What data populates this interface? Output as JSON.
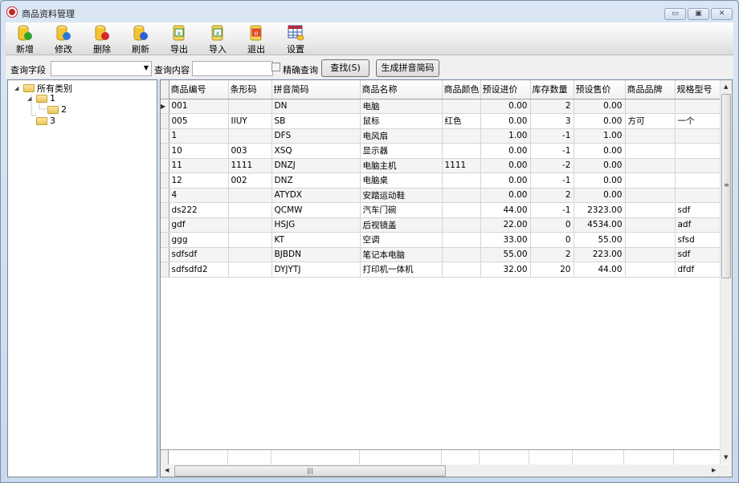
{
  "window": {
    "title": "商品资料管理",
    "controls": {
      "minimize": "▭",
      "maximize": "▣",
      "close": "✕"
    }
  },
  "toolbar": [
    {
      "label": "新增",
      "icon": "db-add-icon",
      "accent": "#2fa52f"
    },
    {
      "label": "修改",
      "icon": "db-edit-icon",
      "accent": "#2a7ad6"
    },
    {
      "label": "删除",
      "icon": "db-delete-icon",
      "accent": "#d8262a"
    },
    {
      "label": "刷新",
      "icon": "db-refresh-icon",
      "accent": "#2e5fd8"
    },
    {
      "label": "导出",
      "icon": "excel-export-icon",
      "accent": "#1f8a3c"
    },
    {
      "label": "导入",
      "icon": "excel-import-icon",
      "accent": "#1f8a3c"
    },
    {
      "label": "退出",
      "icon": "exit-icon",
      "accent": "#d8402a"
    },
    {
      "label": "设置",
      "icon": "settings-table-icon",
      "accent": "#c8242b"
    }
  ],
  "search": {
    "field_label": "查询字段",
    "field_value": "",
    "content_label": "查询内容",
    "content_value": "",
    "exact_label": "精确查询",
    "exact_checked": false,
    "find_button": "查找(S)",
    "pinyin_button": "生成拼音简码"
  },
  "tree": {
    "root": "所有类别",
    "children": [
      {
        "label": "1",
        "children": [
          {
            "label": "2"
          }
        ]
      },
      {
        "label": "3"
      }
    ]
  },
  "grid": {
    "columns": [
      "商品编号",
      "条形码",
      "拼音简码",
      "商品名称",
      "商品颜色",
      "预设进价",
      "库存数量",
      "预设售价",
      "商品品牌",
      "规格型号"
    ],
    "rows": [
      [
        "001",
        "",
        "DN",
        "电脑",
        "",
        "0.00",
        "2",
        "0.00",
        "",
        ""
      ],
      [
        "005",
        "IIUY",
        "SB",
        "鼠标",
        "红色",
        "0.00",
        "3",
        "0.00",
        "方可",
        "一个"
      ],
      [
        "1",
        "",
        "DFS",
        "电风扇",
        "",
        "1.00",
        "-1",
        "1.00",
        "",
        ""
      ],
      [
        "10",
        "003",
        "XSQ",
        "显示器",
        "",
        "0.00",
        "-1",
        "0.00",
        "",
        ""
      ],
      [
        "11",
        "1111",
        "DNZJ",
        "电脑主机",
        "1111",
        "0.00",
        "-2",
        "0.00",
        "",
        ""
      ],
      [
        "12",
        "002",
        "DNZ",
        "电脑桌",
        "",
        "0.00",
        "-1",
        "0.00",
        "",
        ""
      ],
      [
        "4",
        "",
        "ATYDX",
        "安踏运动鞋",
        "",
        "0.00",
        "2",
        "0.00",
        "",
        ""
      ],
      [
        "ds222",
        "",
        "QCMW",
        "汽车门碗",
        "",
        "44.00",
        "-1",
        "2323.00",
        "",
        "sdf"
      ],
      [
        "gdf",
        "",
        "HSJG",
        "后视镜盖",
        "",
        "22.00",
        "0",
        "4534.00",
        "",
        "adf"
      ],
      [
        "ggg",
        "",
        "KT",
        "空调",
        "",
        "33.00",
        "0",
        "55.00",
        "",
        "sfsd"
      ],
      [
        "sdfsdf",
        "",
        "BJBDN",
        "笔记本电脑",
        "",
        "55.00",
        "2",
        "223.00",
        "",
        "sdf"
      ],
      [
        "sdfsdfd2",
        "",
        "DYJYTJ",
        "打印机一体机",
        "",
        "32.00",
        "20",
        "44.00",
        "",
        "dfdf"
      ]
    ],
    "current_row": 0
  }
}
